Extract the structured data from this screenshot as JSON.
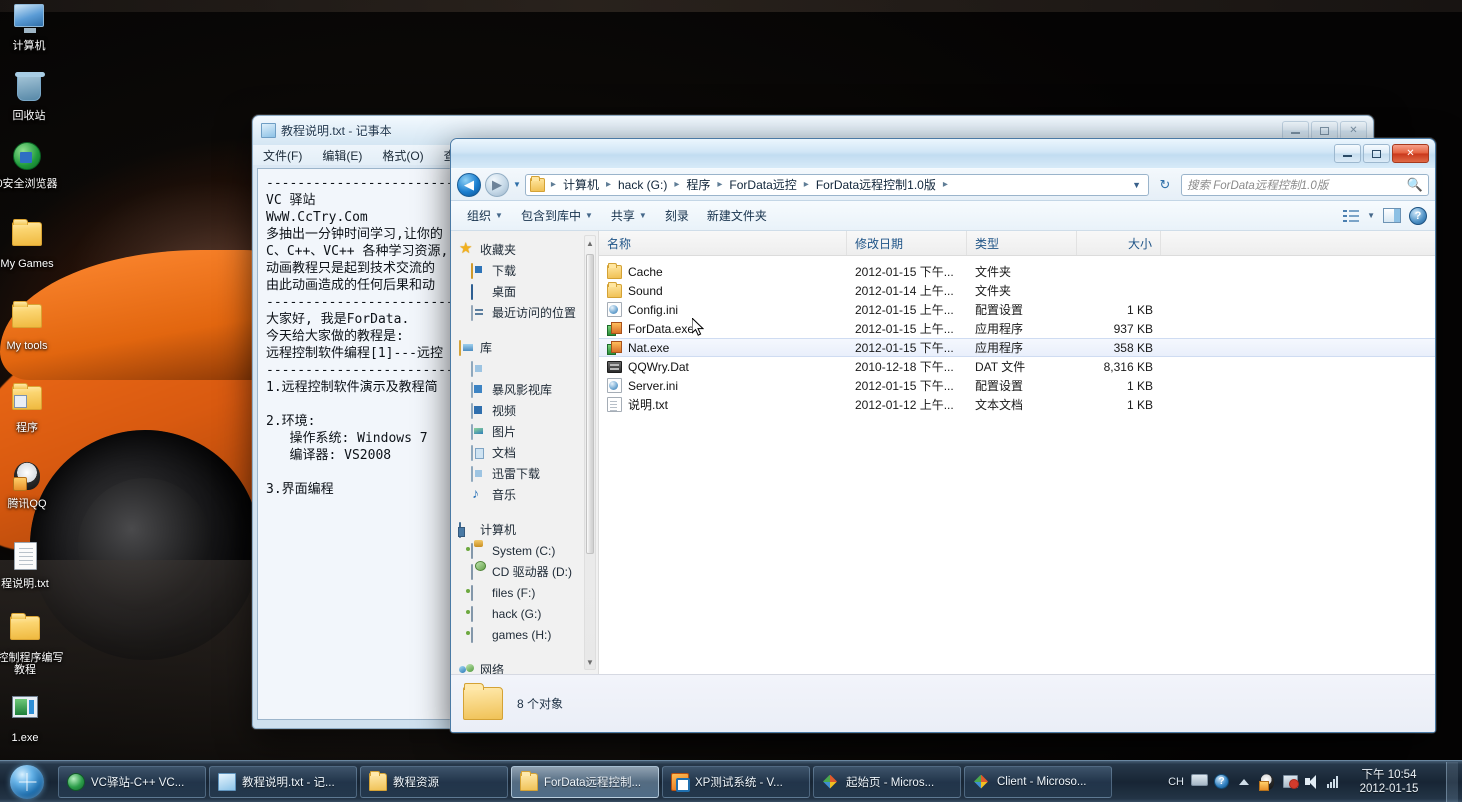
{
  "desktop": {
    "icons": [
      {
        "name": "计算机",
        "icon": "computer-icon"
      },
      {
        "name": "回收站",
        "icon": "recycle-bin-icon"
      },
      {
        "name": "0安全浏览器",
        "icon": "360-browser-icon"
      },
      {
        "name": "My Games",
        "icon": "folder-icon"
      },
      {
        "name": "My tools",
        "icon": "folder-icon"
      },
      {
        "name": "程序",
        "icon": "folder-shortcut-icon"
      },
      {
        "name": "腾讯QQ",
        "icon": "qq-icon"
      },
      {
        "name": "程说明.txt",
        "icon": "text-file-icon"
      },
      {
        "name": "程控制程序编写教程",
        "icon": "folder-icon"
      },
      {
        "name": "1.exe",
        "icon": "application-icon"
      }
    ]
  },
  "notepad": {
    "title": "教程说明.txt - 记事本",
    "menu": [
      "文件(F)",
      "编辑(E)",
      "格式(O)",
      "查看(V"
    ],
    "content": "--------------------------------------------------\nVC 驿站\nWwW.CcTry.Com\n多抽出一分钟时间学习,让你的\nC、C++、VC++ 各种学习资源,\n动画教程只是起到技术交流的\n由此动画造成的任何后果和动\n--------------------------------------------------\n大家好, 我是ForData.\n今天给大家做的教程是:\n远程控制软件编程[1]---远控\n--------------------------------------------------\n1.远程控制软件演示及教程简\n\n2.环境:\n   操作系统: Windows 7\n   编译器: VS2008\n\n3.界面编程",
    "buttons": {
      "minimize": "最小化",
      "maximize": "最大化",
      "close": "关闭"
    }
  },
  "explorer": {
    "breadcrumbs": [
      "计算机",
      "hack (G:)",
      "程序",
      "ForData远控",
      "ForData远程控制1.0版"
    ],
    "search_placeholder": "搜索 ForData远程控制1.0版",
    "toolbar": [
      {
        "label": "组织",
        "caret": true
      },
      {
        "label": "包含到库中",
        "caret": true
      },
      {
        "label": "共享",
        "caret": true
      },
      {
        "label": "刻录",
        "caret": false
      },
      {
        "label": "新建文件夹",
        "caret": false
      }
    ],
    "nav_pane": [
      {
        "label": "收藏夹",
        "icon": "star-icon",
        "indent": false
      },
      {
        "label": "下载",
        "icon": "downloads-icon",
        "indent": true
      },
      {
        "label": "桌面",
        "icon": "desktop-icon",
        "indent": true
      },
      {
        "label": "最近访问的位置",
        "icon": "recent-places-icon",
        "indent": true
      },
      {
        "gap": true
      },
      {
        "label": "库",
        "icon": "library-icon",
        "indent": false
      },
      {
        "label": "",
        "icon": "lock-icon",
        "indent": true
      },
      {
        "label": "暴风影视库",
        "icon": "baofeng-library-icon",
        "indent": true
      },
      {
        "label": "视频",
        "icon": "video-icon",
        "indent": true
      },
      {
        "label": "图片",
        "icon": "pictures-icon",
        "indent": true
      },
      {
        "label": "文档",
        "icon": "documents-icon",
        "indent": true
      },
      {
        "label": "迅雷下载",
        "icon": "thunder-download-icon",
        "indent": true
      },
      {
        "label": "音乐",
        "icon": "music-icon",
        "indent": true
      },
      {
        "gap": true
      },
      {
        "label": "计算机",
        "icon": "computer-icon",
        "indent": false
      },
      {
        "label": "System (C:)",
        "icon": "system-drive-icon",
        "indent": true
      },
      {
        "label": "CD 驱动器 (D:)",
        "icon": "cd-drive-icon",
        "indent": true
      },
      {
        "label": "files (F:)",
        "icon": "drive-icon",
        "indent": true
      },
      {
        "label": "hack (G:)",
        "icon": "drive-icon",
        "indent": true
      },
      {
        "label": "games (H:)",
        "icon": "drive-icon",
        "indent": true
      },
      {
        "gap": true
      },
      {
        "label": "网络",
        "icon": "network-icon",
        "indent": false
      }
    ],
    "columns": [
      "名称",
      "修改日期",
      "类型",
      "大小"
    ],
    "files": [
      {
        "name": "Cache",
        "date": "2012-01-15 下午...",
        "type": "文件夹",
        "size": "",
        "icon": "folder-icon",
        "selected": false
      },
      {
        "name": "Sound",
        "date": "2012-01-14 上午...",
        "type": "文件夹",
        "size": "",
        "icon": "folder-icon",
        "selected": false
      },
      {
        "name": "Config.ini",
        "date": "2012-01-15 上午...",
        "type": "配置设置",
        "size": "1 KB",
        "icon": "ini-file-icon",
        "selected": false
      },
      {
        "name": "ForData.exe",
        "date": "2012-01-15 上午...",
        "type": "应用程序",
        "size": "937 KB",
        "icon": "application-icon",
        "selected": false
      },
      {
        "name": "Nat.exe",
        "date": "2012-01-15 下午...",
        "type": "应用程序",
        "size": "358 KB",
        "icon": "application-icon",
        "selected": true
      },
      {
        "name": "QQWry.Dat",
        "date": "2010-12-18 下午...",
        "type": "DAT 文件",
        "size": "8,316 KB",
        "icon": "dat-file-icon",
        "selected": false
      },
      {
        "name": "Server.ini",
        "date": "2012-01-15 下午...",
        "type": "配置设置",
        "size": "1 KB",
        "icon": "ini-file-icon",
        "selected": false
      },
      {
        "name": "说明.txt",
        "date": "2012-01-12 上午...",
        "type": "文本文档",
        "size": "1 KB",
        "icon": "text-file-icon",
        "selected": false
      }
    ],
    "status": "8 个对象"
  },
  "taskbar": {
    "items": [
      {
        "label": "VC驿站-C++ VC...",
        "icon": "ie-icon",
        "active": false
      },
      {
        "label": "教程说明.txt - 记...",
        "icon": "notepad-icon",
        "active": false
      },
      {
        "label": "教程资源",
        "icon": "folder-icon",
        "active": false
      },
      {
        "label": "ForData远程控制...",
        "icon": "folder-icon",
        "active": true
      },
      {
        "label": "XP测试系统 - V...",
        "icon": "vmware-icon",
        "active": false
      },
      {
        "label": "起始页 - Micros...",
        "icon": "visual-studio-icon",
        "active": false
      },
      {
        "label": "Client - Microso...",
        "icon": "visual-studio-icon",
        "active": false
      }
    ],
    "tray": {
      "ime": "CH",
      "icons": [
        "keyboard-icon",
        "help-icon",
        "show-hidden-icon",
        "qq-icon",
        "network-icon",
        "volume-icon",
        "signal-icon"
      ]
    },
    "clock": {
      "time": "下午 10:54",
      "date": "2012-01-15"
    }
  },
  "colors": {
    "accent": "#1f6fae",
    "selection": "#e9effb",
    "taskbar": "#182636",
    "folder": "#f0c257"
  }
}
